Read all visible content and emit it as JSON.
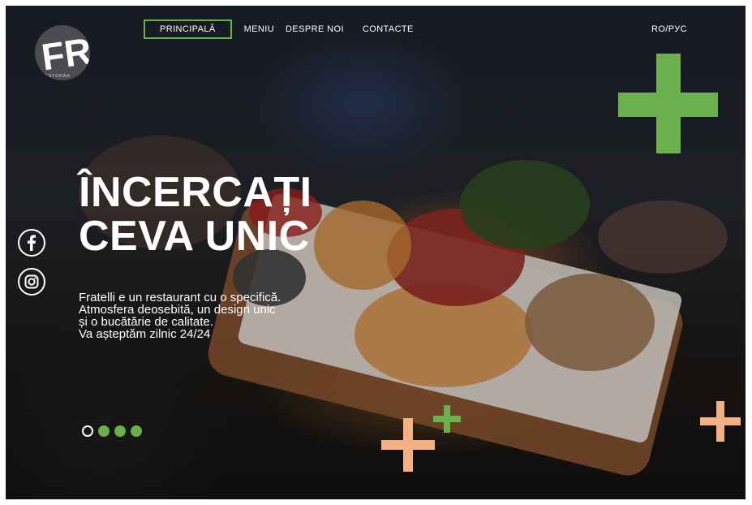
{
  "nav": {
    "items": [
      {
        "label": "PRINCIPALĂ",
        "active": true
      },
      {
        "label": "MENIU",
        "active": false
      },
      {
        "label": "DESPRE NOI",
        "active": false
      },
      {
        "label": "CONTACTE",
        "active": false
      }
    ],
    "language": "RO/РУС"
  },
  "logo": {
    "letters": "FR",
    "ring_text": "RESTORAN"
  },
  "hero": {
    "headline_line1": "ÎNCERCAȚI",
    "headline_line2": "CEVA UNIC",
    "description_lines": [
      "Fratelli e un restaurant cu o specifică.",
      "Atmosfera deosebită, un design unic",
      "și o bucătărie de calitate.",
      "Va așteptăm zilnic 24/24"
    ]
  },
  "social": [
    {
      "icon": "facebook-icon"
    },
    {
      "icon": "instagram-icon"
    }
  ],
  "slider": {
    "total": 4,
    "current": 1
  },
  "colors": {
    "accent_green": "#6ab04c",
    "accent_peach": "#f4b183",
    "text": "#ffffff"
  }
}
